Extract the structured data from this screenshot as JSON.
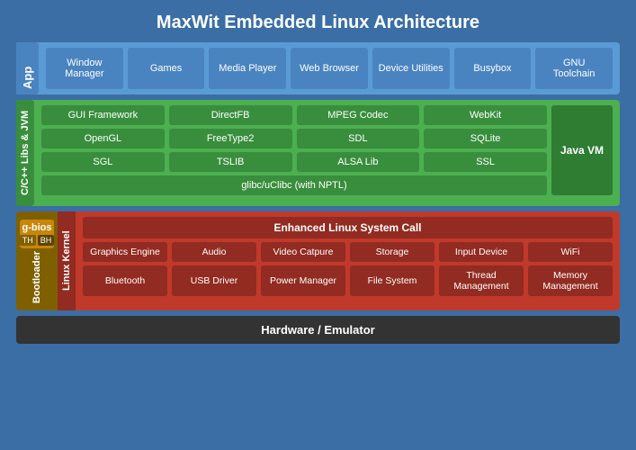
{
  "title": "MaxWit Embedded Linux Architecture",
  "layers": {
    "app": {
      "label": "App",
      "items": [
        {
          "text": "Window Manager"
        },
        {
          "text": "Games"
        },
        {
          "text": "Media Player"
        },
        {
          "text": "Web Browser"
        },
        {
          "text": "Device Utilities"
        },
        {
          "text": "Busybox"
        },
        {
          "text": "GNU Toolchain"
        }
      ]
    },
    "libs": {
      "label": "C/C++ Libs & JVM",
      "row1": [
        {
          "text": "GUI Framework"
        },
        {
          "text": "DirectFB"
        },
        {
          "text": "MPEG Codec"
        },
        {
          "text": "WebKit"
        }
      ],
      "row2": [
        {
          "text": "OpenGL"
        },
        {
          "text": "FreeType2"
        },
        {
          "text": "SDL"
        },
        {
          "text": "SQLite"
        }
      ],
      "row3": [
        {
          "text": "SGL"
        },
        {
          "text": "TSLIB"
        },
        {
          "text": "ALSA Lib"
        },
        {
          "text": "SSL"
        }
      ],
      "glibc": "glibc/uClibc (with NPTL)",
      "javavm": "Java VM"
    },
    "kernel": {
      "label": "Linux Kernel",
      "bootloader": "Bootloader",
      "gbios": "g-bios",
      "gbios_th": "TH",
      "gbios_bh": "BH",
      "syscall": "Enhanced Linux System Call",
      "row1": [
        {
          "text": "Graphics Engine"
        },
        {
          "text": "Audio"
        },
        {
          "text": "Video Catpure"
        },
        {
          "text": "Storage"
        },
        {
          "text": "Input Device"
        },
        {
          "text": "WiFi"
        }
      ],
      "row2": [
        {
          "text": "Bluetooth"
        },
        {
          "text": "USB Driver"
        },
        {
          "text": "Power Manager"
        },
        {
          "text": "File System"
        },
        {
          "text": "Thread Management"
        },
        {
          "text": "Memory Management"
        }
      ]
    },
    "hardware": {
      "label": "Hardware / Emulator"
    }
  }
}
